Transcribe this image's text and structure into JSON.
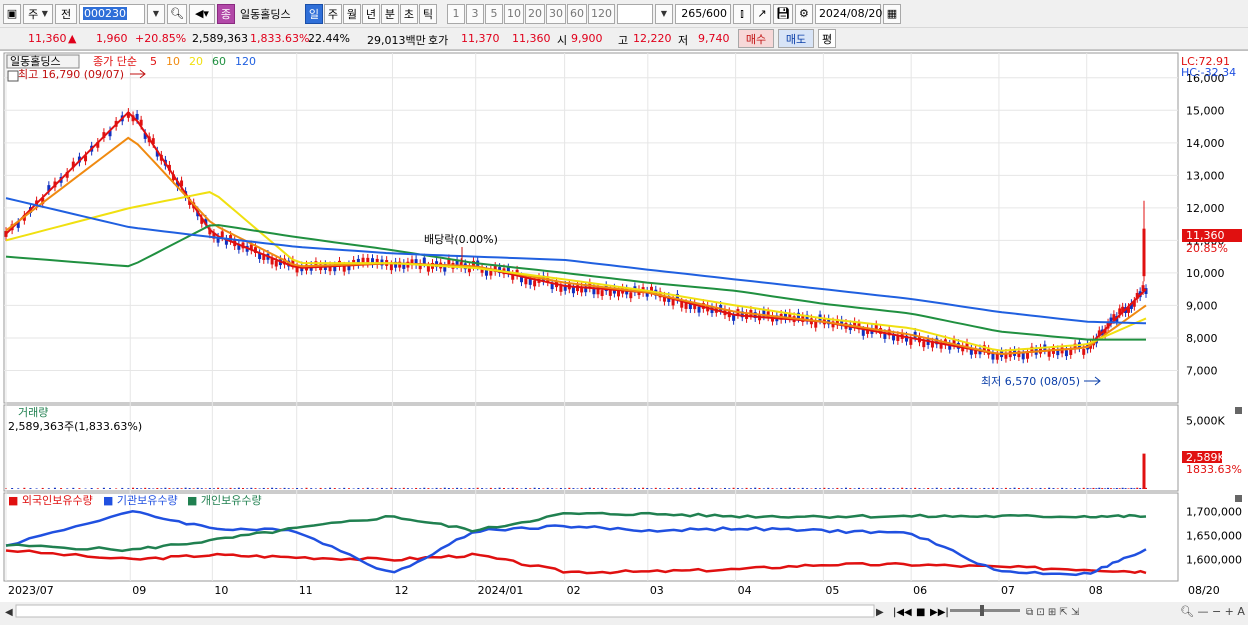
{
  "toolbar": {
    "market_label": "주",
    "prev_label": "전",
    "stock_code": "000230",
    "stock_name": "일동홀딩스",
    "stock_badge": "종",
    "period_tabs": [
      "일",
      "주",
      "월",
      "년",
      "분",
      "초",
      "틱"
    ],
    "active_period": "일",
    "interval_buttons": [
      "1",
      "3",
      "5",
      "10",
      "20",
      "30",
      "60",
      "120"
    ],
    "count_display": "265",
    "count_max": "/600",
    "date": "2024/08/20"
  },
  "info": {
    "price": "11,360",
    "change_arrow": "▲",
    "change": "1,960",
    "change_pct": "+20.85%",
    "volume": "2,589,363",
    "volume_ratio": "1,833.63%",
    "turnover": "22.44%",
    "trade_value": "29,013백만",
    "quote_label": "호가",
    "ask": "11,370",
    "bid": "11,360",
    "open_label": "시",
    "open": "9,900",
    "high_label": "고",
    "high": "12,220",
    "low_label": "저",
    "low": "9,740",
    "buy_label": "매수",
    "sell_label": "매도",
    "eval_label": "평"
  },
  "chart": {
    "legend_name": "일동홀딩스",
    "legend_ma": "종가 단순",
    "ma_periods": [
      "5",
      "10",
      "20",
      "60",
      "120"
    ],
    "ma_colors": [
      "#e01010",
      "#f08a10",
      "#f0e010",
      "#209040",
      "#2060e0"
    ],
    "lc_label": "LC:72.91",
    "hc_label": "HC:-32.34",
    "max_annotation": "최고 16,790 (09/07)",
    "min_annotation": "최저 6,570 (08/05)",
    "dividend_annotation": "배당락(0.00%)",
    "current_price_tag": "11,360",
    "current_pct_tag": "20.85%",
    "volume_title": "거래량",
    "volume_summary": "2,589,363주(1,833.63%)",
    "volume_tag": "2,589K",
    "volume_pct_tag": "1833.63%",
    "holdings_legend": [
      "외국인보유수량",
      "기관보유수량",
      "개인보유수량"
    ],
    "holdings_colors": [
      "#e01010",
      "#2050e0",
      "#208050"
    ],
    "x_labels": [
      "2023/07",
      "09",
      "10",
      "11",
      "12",
      "2024/01",
      "02",
      "03",
      "04",
      "05",
      "06",
      "07",
      "08"
    ],
    "x_end_label": "08/20"
  },
  "chart_data": [
    {
      "type": "line",
      "title": "일동홀딩스",
      "ylim": [
        6000,
        16700
      ],
      "y_ticks": [
        "16,000",
        "15,000",
        "14,000",
        "13,000",
        "12,000",
        "11,000",
        "10,000",
        "9,000",
        "8,000",
        "7,000"
      ],
      "x": [
        "2023/07",
        "09",
        "10",
        "11",
        "12",
        "2024/01",
        "02",
        "03",
        "04",
        "05",
        "06",
        "07",
        "08",
        "08/20"
      ],
      "series": [
        {
          "name": "5",
          "values": [
            11200,
            15000,
            11200,
            10150,
            10300,
            10200,
            9600,
            9400,
            8700,
            8500,
            8000,
            7500,
            7700,
            9500
          ]
        },
        {
          "name": "10",
          "values": [
            11300,
            14200,
            11500,
            10200,
            10300,
            10200,
            9700,
            9400,
            8800,
            8500,
            8100,
            7500,
            7700,
            9000
          ]
        },
        {
          "name": "20",
          "values": [
            11000,
            12000,
            12500,
            10300,
            10300,
            10150,
            9800,
            9450,
            9000,
            8600,
            8300,
            7600,
            7800,
            8600
          ]
        },
        {
          "name": "60",
          "values": [
            10500,
            10200,
            11500,
            11100,
            10700,
            10300,
            10000,
            9700,
            9450,
            9050,
            8750,
            8200,
            7950,
            7950
          ]
        },
        {
          "name": "120",
          "values": [
            12300,
            11400,
            11100,
            10800,
            10600,
            10500,
            10400,
            10100,
            9800,
            9500,
            9200,
            8800,
            8500,
            8450
          ]
        }
      ],
      "annotations": {
        "max": 16790,
        "min": 6570,
        "last_close": 11360,
        "last_high": 12220,
        "last_low": 9740,
        "last_open": 9900
      }
    },
    {
      "type": "bar",
      "title": "거래량",
      "ylim": [
        0,
        6000
      ],
      "y_ticks": [
        "5,000K"
      ],
      "last_value_k": 2589
    },
    {
      "type": "line",
      "title": "보유수량",
      "ylim": [
        1560000,
        1730000
      ],
      "y_ticks": [
        "1,700,000",
        "1,650,000",
        "1,600,000"
      ],
      "x": [
        "2023/07",
        "09",
        "10",
        "11",
        "12",
        "2024/01",
        "02",
        "03",
        "04",
        "05",
        "06",
        "07",
        "08",
        "08/20"
      ],
      "series": [
        {
          "name": "외국인보유수량",
          "values": [
            1620000,
            1600000,
            1610000,
            1605000,
            1600000,
            1610000,
            1575000,
            1575000,
            1580000,
            1590000,
            1590000,
            1585000,
            1580000,
            1575000
          ]
        },
        {
          "name": "기관보유수량",
          "values": [
            1630000,
            1700000,
            1665000,
            1660000,
            1570000,
            1660000,
            1670000,
            1660000,
            1665000,
            1660000,
            1655000,
            1575000,
            1570000,
            1620000
          ]
        },
        {
          "name": "개인보유수량",
          "values": [
            1630000,
            1620000,
            1640000,
            1665000,
            1690000,
            1660000,
            1695000,
            1695000,
            1690000,
            1690000,
            1690000,
            1690000,
            1690000,
            1690000
          ]
        }
      ]
    }
  ]
}
